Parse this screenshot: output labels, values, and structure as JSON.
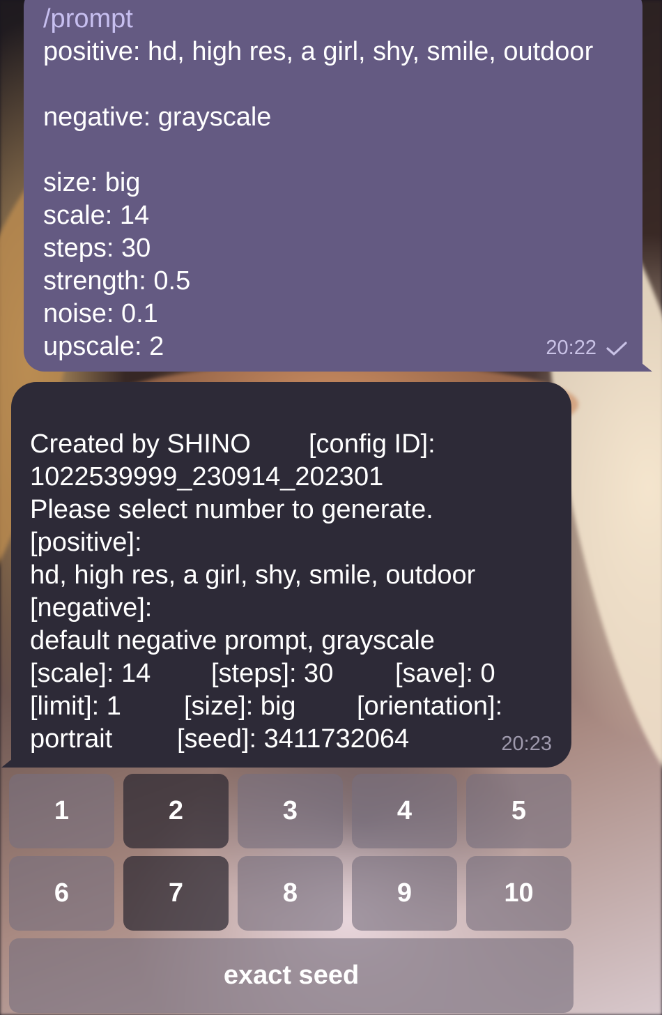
{
  "outgoing_message": {
    "command": "/prompt",
    "lines_a": [
      "positive: hd, high res, a girl, shy, smile, outdoor"
    ],
    "lines_b": [
      "negative: grayscale"
    ],
    "lines_c": [
      "size: big",
      "scale: 14",
      "steps: 30",
      "strength: 0.5",
      "noise: 0.1",
      "upscale: 2"
    ],
    "time": "20:22",
    "status_icon": "check-icon"
  },
  "incoming_message": {
    "created_by": "Created by SHINO",
    "config_label": "[config ID]:",
    "config_id": "1022539999_230914_202301",
    "instruction": "Please select number to generate.",
    "positive_label": "[positive]:",
    "positive_value": "hd, high res, a girl, shy, smile, outdoor",
    "negative_label": "[negative]:",
    "negative_value": "default negative prompt, grayscale",
    "scale": "[scale]: 14",
    "steps": "[steps]: 30",
    "save": "[save]: 0",
    "limit": "[limit]: 1",
    "size": "[size]: big",
    "orientation": "[orientation]:",
    "orientation_value": "portrait",
    "seed": "[seed]: 3411732064",
    "time": "20:23"
  },
  "keyboard": {
    "row1": [
      "1",
      "2",
      "3",
      "4",
      "5"
    ],
    "row2": [
      "6",
      "7",
      "8",
      "9",
      "10"
    ],
    "exact_seed": "exact seed"
  },
  "colors": {
    "outgoing_bubble": "#645a82",
    "incoming_bubble": "#2d2a37",
    "key_background": "#78707e"
  }
}
